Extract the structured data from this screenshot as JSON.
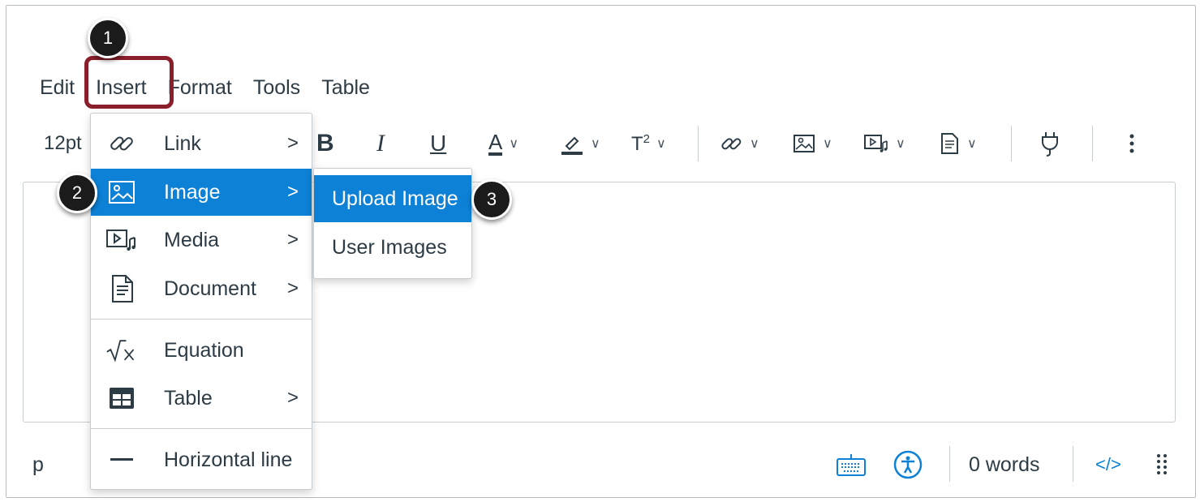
{
  "menubar": {
    "items": [
      "Edit",
      "Insert",
      "Format",
      "Tools",
      "Table"
    ]
  },
  "toolbar": {
    "font_size": "12pt",
    "superscript_label": "T",
    "superscript_sup": "2"
  },
  "insert_menu": {
    "items": [
      {
        "label": "Link",
        "icon": "link-icon",
        "has_submenu": true
      },
      {
        "label": "Image",
        "icon": "image-icon",
        "has_submenu": true,
        "selected": true
      },
      {
        "label": "Media",
        "icon": "media-icon",
        "has_submenu": true
      },
      {
        "label": "Document",
        "icon": "document-icon",
        "has_submenu": true
      },
      {
        "label": "Equation",
        "icon": "equation-icon",
        "has_submenu": false
      },
      {
        "label": "Table",
        "icon": "table-icon",
        "has_submenu": true
      },
      {
        "label": "Horizontal line",
        "icon": "horizontal-line-icon",
        "has_submenu": false
      }
    ],
    "arrow": ">"
  },
  "image_submenu": {
    "items": [
      {
        "label": "Upload Image",
        "selected": true
      },
      {
        "label": "User Images"
      }
    ]
  },
  "callouts": [
    "1",
    "2",
    "3"
  ],
  "statusbar": {
    "element_path": "p",
    "word_count": "0 words",
    "html_toggle": "</>"
  },
  "colors": {
    "accent": "#0d81d6",
    "highlight_border": "#8b1e2b",
    "text": "#2d3b45",
    "callout_bg": "#1b1b1b"
  }
}
